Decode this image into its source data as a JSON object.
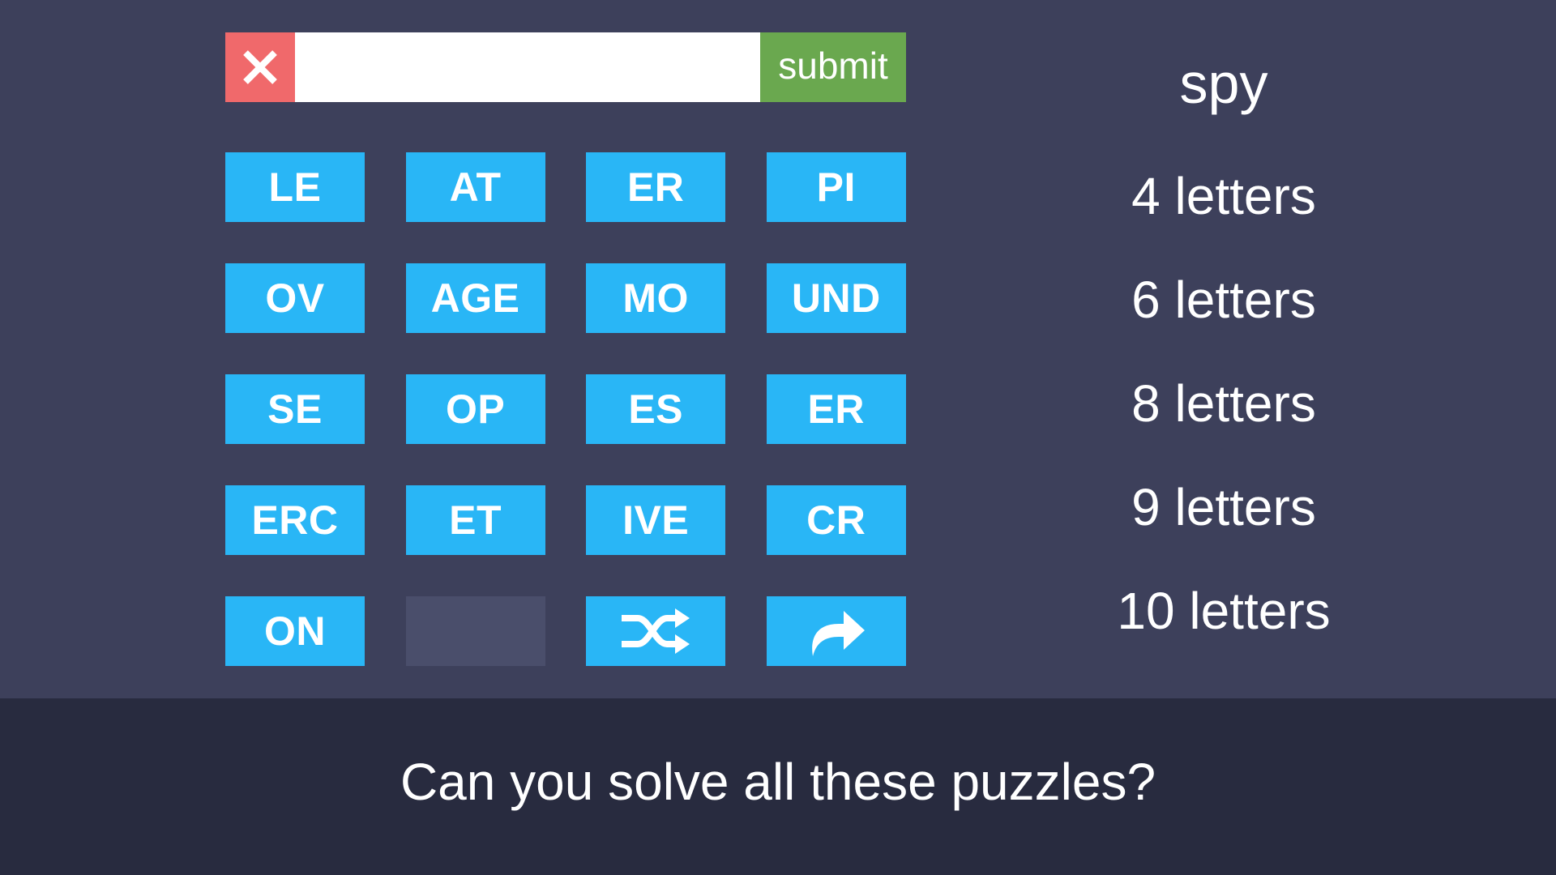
{
  "input_bar": {
    "clear_icon": "close-icon",
    "answer_value": "",
    "submit_label": "submit"
  },
  "tiles": [
    [
      "LE",
      "AT",
      "ER",
      "PI"
    ],
    [
      "OV",
      "AGE",
      "MO",
      "UND"
    ],
    [
      "SE",
      "OP",
      "ES",
      "ER"
    ],
    [
      "ERC",
      "ET",
      "IVE",
      "CR"
    ],
    [
      "ON",
      "",
      "",
      ""
    ]
  ],
  "controls": {
    "shuffle_icon": "shuffle-icon",
    "skip_icon": "redo-arrow-icon"
  },
  "clue": {
    "word": "spy",
    "lengths": [
      "4 letters",
      "6 letters",
      "8 letters",
      "9 letters",
      "10 letters"
    ]
  },
  "footer": {
    "text": "Can you solve all these puzzles?"
  },
  "colors": {
    "background": "#3d405b",
    "tile": "#29b6f6",
    "empty_tile": "#4a4e6b",
    "clear_button": "#f0696b",
    "submit_button": "#6aa84f",
    "footer": "#282b3f"
  }
}
